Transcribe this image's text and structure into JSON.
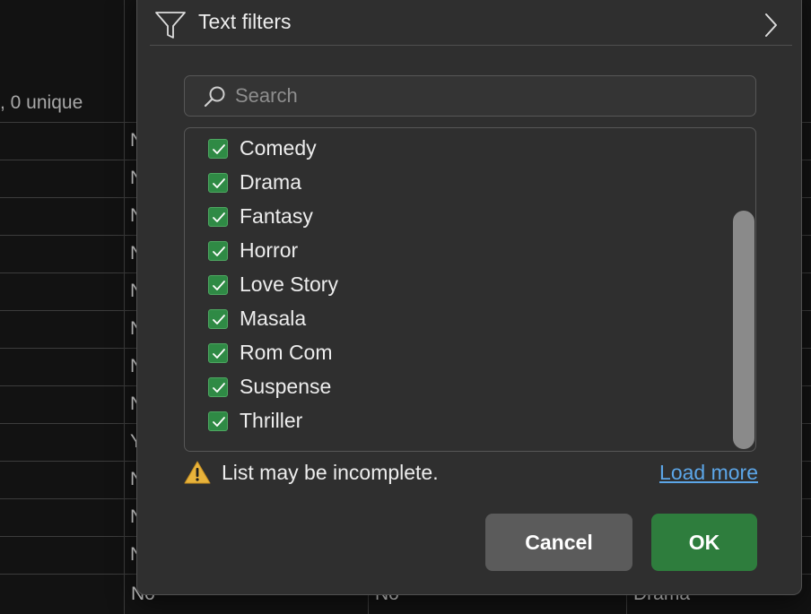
{
  "column_header": {
    "stat_text": ", 0 unique"
  },
  "grid": {
    "row_peek_values": [
      "N",
      "N",
      "N",
      "N",
      "N",
      "N",
      "N",
      "N",
      "Y",
      "N",
      "N",
      "N"
    ],
    "bottom_row": [
      "No",
      "No",
      "Drama"
    ]
  },
  "filter_panel": {
    "text_filters_label": "Text filters",
    "search": {
      "placeholder": "Search",
      "value": ""
    },
    "items": [
      {
        "label": "Comedy",
        "checked": true
      },
      {
        "label": "Drama",
        "checked": true
      },
      {
        "label": "Fantasy",
        "checked": true
      },
      {
        "label": "Horror",
        "checked": true
      },
      {
        "label": "Love Story",
        "checked": true
      },
      {
        "label": "Masala",
        "checked": true
      },
      {
        "label": "Rom Com",
        "checked": true
      },
      {
        "label": "Suspense",
        "checked": true
      },
      {
        "label": "Thriller",
        "checked": true
      }
    ],
    "warning_text": "List may be incomplete.",
    "load_more_label": "Load more",
    "cancel_label": "Cancel",
    "ok_label": "OK"
  },
  "colors": {
    "checkbox_green": "#2f8a45",
    "ok_button": "#2e7d3d",
    "link_blue": "#5ca6e8",
    "warning_yellow": "#e8b33b"
  },
  "icons": {
    "filter": "funnel-icon",
    "submenu": "chevron-right-icon",
    "search": "search-icon",
    "check": "checkmark-icon",
    "warning": "warning-triangle-icon"
  }
}
